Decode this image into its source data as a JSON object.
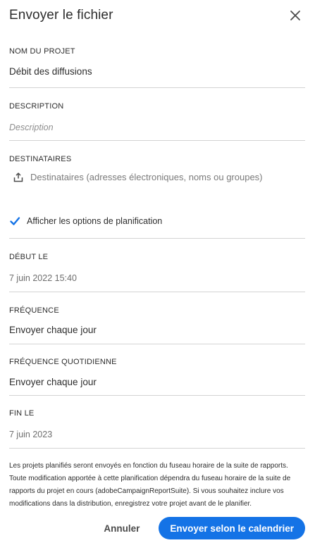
{
  "dialog": {
    "title": "Envoyer le fichier",
    "close_icon": "close-icon"
  },
  "project_name": {
    "label": "NOM DU PROJET",
    "value": "Débit des diffusions"
  },
  "description": {
    "label": "DESCRIPTION",
    "placeholder": "Description"
  },
  "recipients": {
    "label": "DESTINATAIRES",
    "icon": "share-icon",
    "placeholder": "Destinataires (adresses électroniques, noms ou groupes)"
  },
  "schedule_toggle": {
    "label": "Afficher les options de planification",
    "checked": true
  },
  "start": {
    "label": "DÉBUT LE",
    "value": "7 juin 2022 15:40"
  },
  "frequency": {
    "label": "FRÉQUENCE",
    "value": "Envoyer chaque jour"
  },
  "daily_frequency": {
    "label": "FRÉQUENCE QUOTIDIENNE",
    "value": "Envoyer chaque jour"
  },
  "end": {
    "label": "FIN LE",
    "value": "7 juin 2023"
  },
  "note": "Les projets planifiés seront envoyés en fonction du fuseau horaire de la suite de rapports. Toute modification apportée à cette planification dépendra du fuseau horaire de la suite de rapports du projet en cours (adobeCampaignReportSuite). Si vous souhaitez inclure vos modifications dans la distribution, enregistrez votre projet avant de le planifier.",
  "footer": {
    "cancel_label": "Annuler",
    "submit_label": "Envoyer selon le calendrier"
  },
  "colors": {
    "accent": "#1473e6",
    "divider": "#d3d3d3"
  }
}
